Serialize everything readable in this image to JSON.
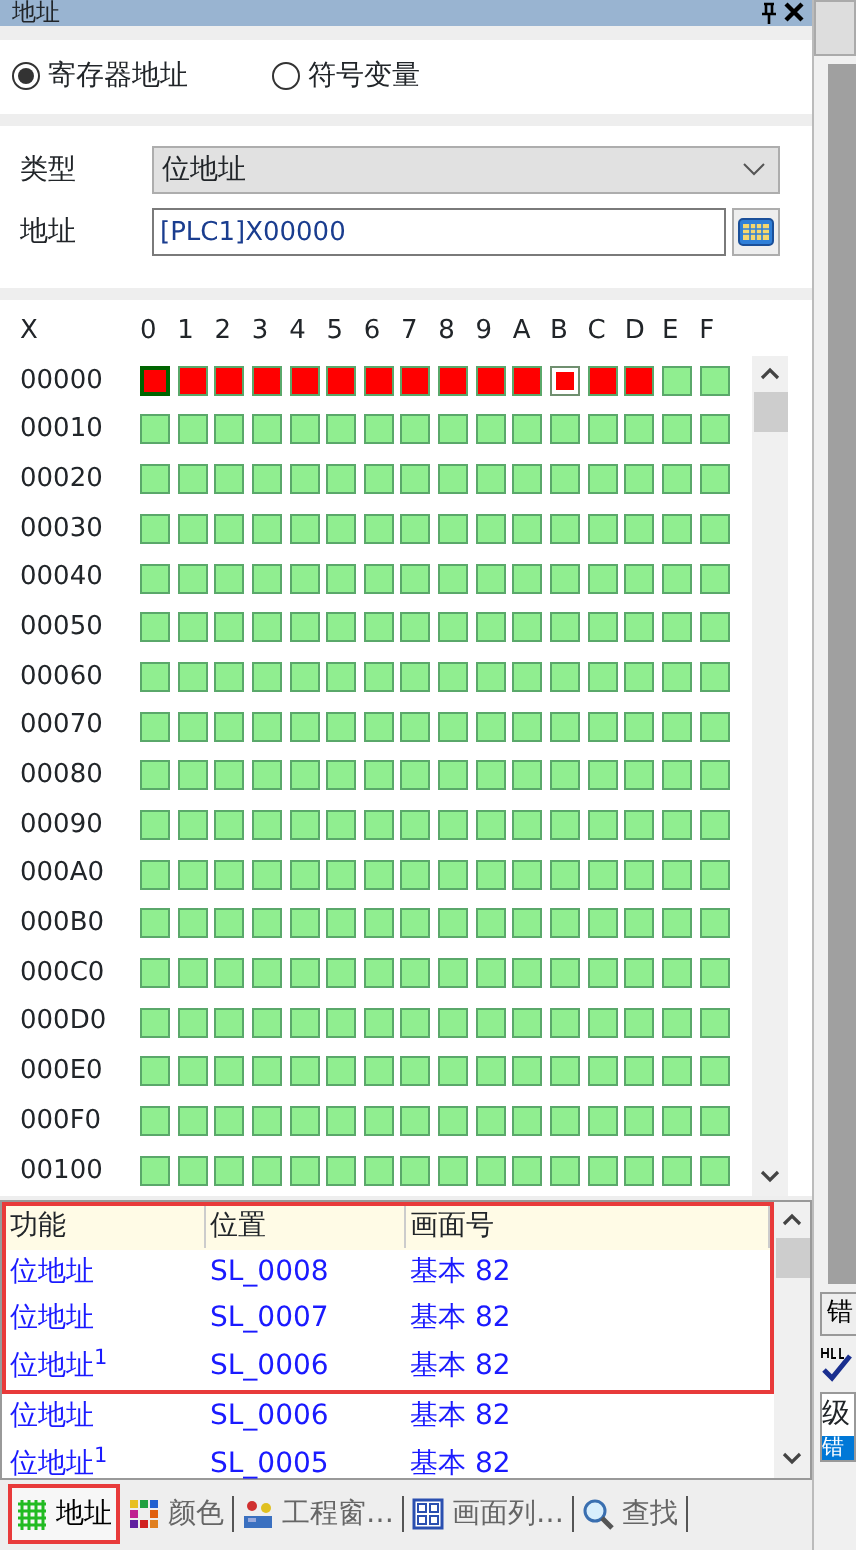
{
  "panel": {
    "title": "地址"
  },
  "mode_options": [
    {
      "label": "寄存器地址",
      "selected": true
    },
    {
      "label": "符号变量",
      "selected": false
    }
  ],
  "form": {
    "type_label": "类型",
    "type_value": "位地址",
    "address_label": "地址",
    "address_value": "[PLC1]X00000"
  },
  "grid": {
    "corner": "X",
    "columns": [
      "0",
      "1",
      "2",
      "3",
      "4",
      "5",
      "6",
      "7",
      "8",
      "9",
      "A",
      "B",
      "C",
      "D",
      "E",
      "F"
    ],
    "rows": [
      {
        "label": "00000",
        "on": [
          true,
          true,
          true,
          true,
          true,
          true,
          true,
          true,
          true,
          true,
          true,
          true,
          true,
          true,
          false,
          false
        ],
        "selected": [
          true,
          false,
          false,
          false,
          false,
          false,
          false,
          false,
          false,
          false,
          false,
          false,
          false,
          false,
          false,
          false
        ],
        "focused": [
          false,
          false,
          false,
          false,
          false,
          false,
          false,
          false,
          false,
          false,
          false,
          true,
          false,
          false,
          false,
          false
        ]
      },
      {
        "label": "00010",
        "on": [
          false,
          false,
          false,
          false,
          false,
          false,
          false,
          false,
          false,
          false,
          false,
          false,
          false,
          false,
          false,
          false
        ],
        "selected": [
          false,
          false,
          false,
          false,
          false,
          false,
          false,
          false,
          false,
          false,
          false,
          false,
          false,
          false,
          false,
          false
        ],
        "focused": [
          false,
          false,
          false,
          false,
          false,
          false,
          false,
          false,
          false,
          false,
          false,
          false,
          false,
          false,
          false,
          false
        ]
      },
      {
        "label": "00020",
        "on": [
          false,
          false,
          false,
          false,
          false,
          false,
          false,
          false,
          false,
          false,
          false,
          false,
          false,
          false,
          false,
          false
        ],
        "selected": [
          false,
          false,
          false,
          false,
          false,
          false,
          false,
          false,
          false,
          false,
          false,
          false,
          false,
          false,
          false,
          false
        ],
        "focused": [
          false,
          false,
          false,
          false,
          false,
          false,
          false,
          false,
          false,
          false,
          false,
          false,
          false,
          false,
          false,
          false
        ]
      },
      {
        "label": "00030",
        "on": [
          false,
          false,
          false,
          false,
          false,
          false,
          false,
          false,
          false,
          false,
          false,
          false,
          false,
          false,
          false,
          false
        ],
        "selected": [
          false,
          false,
          false,
          false,
          false,
          false,
          false,
          false,
          false,
          false,
          false,
          false,
          false,
          false,
          false,
          false
        ],
        "focused": [
          false,
          false,
          false,
          false,
          false,
          false,
          false,
          false,
          false,
          false,
          false,
          false,
          false,
          false,
          false,
          false
        ]
      },
      {
        "label": "00040",
        "on": [
          false,
          false,
          false,
          false,
          false,
          false,
          false,
          false,
          false,
          false,
          false,
          false,
          false,
          false,
          false,
          false
        ],
        "selected": [
          false,
          false,
          false,
          false,
          false,
          false,
          false,
          false,
          false,
          false,
          false,
          false,
          false,
          false,
          false,
          false
        ],
        "focused": [
          false,
          false,
          false,
          false,
          false,
          false,
          false,
          false,
          false,
          false,
          false,
          false,
          false,
          false,
          false,
          false
        ]
      },
      {
        "label": "00050",
        "on": [
          false,
          false,
          false,
          false,
          false,
          false,
          false,
          false,
          false,
          false,
          false,
          false,
          false,
          false,
          false,
          false
        ],
        "selected": [
          false,
          false,
          false,
          false,
          false,
          false,
          false,
          false,
          false,
          false,
          false,
          false,
          false,
          false,
          false,
          false
        ],
        "focused": [
          false,
          false,
          false,
          false,
          false,
          false,
          false,
          false,
          false,
          false,
          false,
          false,
          false,
          false,
          false,
          false
        ]
      },
      {
        "label": "00060",
        "on": [
          false,
          false,
          false,
          false,
          false,
          false,
          false,
          false,
          false,
          false,
          false,
          false,
          false,
          false,
          false,
          false
        ],
        "selected": [
          false,
          false,
          false,
          false,
          false,
          false,
          false,
          false,
          false,
          false,
          false,
          false,
          false,
          false,
          false,
          false
        ],
        "focused": [
          false,
          false,
          false,
          false,
          false,
          false,
          false,
          false,
          false,
          false,
          false,
          false,
          false,
          false,
          false,
          false
        ]
      },
      {
        "label": "00070",
        "on": [
          false,
          false,
          false,
          false,
          false,
          false,
          false,
          false,
          false,
          false,
          false,
          false,
          false,
          false,
          false,
          false
        ],
        "selected": [
          false,
          false,
          false,
          false,
          false,
          false,
          false,
          false,
          false,
          false,
          false,
          false,
          false,
          false,
          false,
          false
        ],
        "focused": [
          false,
          false,
          false,
          false,
          false,
          false,
          false,
          false,
          false,
          false,
          false,
          false,
          false,
          false,
          false,
          false
        ]
      },
      {
        "label": "00080",
        "on": [
          false,
          false,
          false,
          false,
          false,
          false,
          false,
          false,
          false,
          false,
          false,
          false,
          false,
          false,
          false,
          false
        ],
        "selected": [
          false,
          false,
          false,
          false,
          false,
          false,
          false,
          false,
          false,
          false,
          false,
          false,
          false,
          false,
          false,
          false
        ],
        "focused": [
          false,
          false,
          false,
          false,
          false,
          false,
          false,
          false,
          false,
          false,
          false,
          false,
          false,
          false,
          false,
          false
        ]
      },
      {
        "label": "00090",
        "on": [
          false,
          false,
          false,
          false,
          false,
          false,
          false,
          false,
          false,
          false,
          false,
          false,
          false,
          false,
          false,
          false
        ],
        "selected": [
          false,
          false,
          false,
          false,
          false,
          false,
          false,
          false,
          false,
          false,
          false,
          false,
          false,
          false,
          false,
          false
        ],
        "focused": [
          false,
          false,
          false,
          false,
          false,
          false,
          false,
          false,
          false,
          false,
          false,
          false,
          false,
          false,
          false,
          false
        ]
      },
      {
        "label": "000A0",
        "on": [
          false,
          false,
          false,
          false,
          false,
          false,
          false,
          false,
          false,
          false,
          false,
          false,
          false,
          false,
          false,
          false
        ],
        "selected": [
          false,
          false,
          false,
          false,
          false,
          false,
          false,
          false,
          false,
          false,
          false,
          false,
          false,
          false,
          false,
          false
        ],
        "focused": [
          false,
          false,
          false,
          false,
          false,
          false,
          false,
          false,
          false,
          false,
          false,
          false,
          false,
          false,
          false,
          false
        ]
      },
      {
        "label": "000B0",
        "on": [
          false,
          false,
          false,
          false,
          false,
          false,
          false,
          false,
          false,
          false,
          false,
          false,
          false,
          false,
          false,
          false
        ],
        "selected": [
          false,
          false,
          false,
          false,
          false,
          false,
          false,
          false,
          false,
          false,
          false,
          false,
          false,
          false,
          false,
          false
        ],
        "focused": [
          false,
          false,
          false,
          false,
          false,
          false,
          false,
          false,
          false,
          false,
          false,
          false,
          false,
          false,
          false,
          false
        ]
      },
      {
        "label": "000C0",
        "on": [
          false,
          false,
          false,
          false,
          false,
          false,
          false,
          false,
          false,
          false,
          false,
          false,
          false,
          false,
          false,
          false
        ],
        "selected": [
          false,
          false,
          false,
          false,
          false,
          false,
          false,
          false,
          false,
          false,
          false,
          false,
          false,
          false,
          false,
          false
        ],
        "focused": [
          false,
          false,
          false,
          false,
          false,
          false,
          false,
          false,
          false,
          false,
          false,
          false,
          false,
          false,
          false,
          false
        ]
      },
      {
        "label": "000D0",
        "on": [
          false,
          false,
          false,
          false,
          false,
          false,
          false,
          false,
          false,
          false,
          false,
          false,
          false,
          false,
          false,
          false
        ],
        "selected": [
          false,
          false,
          false,
          false,
          false,
          false,
          false,
          false,
          false,
          false,
          false,
          false,
          false,
          false,
          false,
          false
        ],
        "focused": [
          false,
          false,
          false,
          false,
          false,
          false,
          false,
          false,
          false,
          false,
          false,
          false,
          false,
          false,
          false,
          false
        ]
      },
      {
        "label": "000E0",
        "on": [
          false,
          false,
          false,
          false,
          false,
          false,
          false,
          false,
          false,
          false,
          false,
          false,
          false,
          false,
          false,
          false
        ],
        "selected": [
          false,
          false,
          false,
          false,
          false,
          false,
          false,
          false,
          false,
          false,
          false,
          false,
          false,
          false,
          false,
          false
        ],
        "focused": [
          false,
          false,
          false,
          false,
          false,
          false,
          false,
          false,
          false,
          false,
          false,
          false,
          false,
          false,
          false,
          false
        ]
      },
      {
        "label": "000F0",
        "on": [
          false,
          false,
          false,
          false,
          false,
          false,
          false,
          false,
          false,
          false,
          false,
          false,
          false,
          false,
          false,
          false
        ],
        "selected": [
          false,
          false,
          false,
          false,
          false,
          false,
          false,
          false,
          false,
          false,
          false,
          false,
          false,
          false,
          false,
          false
        ],
        "focused": [
          false,
          false,
          false,
          false,
          false,
          false,
          false,
          false,
          false,
          false,
          false,
          false,
          false,
          false,
          false,
          false
        ]
      },
      {
        "label": "00100",
        "on": [
          false,
          false,
          false,
          false,
          false,
          false,
          false,
          false,
          false,
          false,
          false,
          false,
          false,
          false,
          false,
          false
        ],
        "selected": [
          false,
          false,
          false,
          false,
          false,
          false,
          false,
          false,
          false,
          false,
          false,
          false,
          false,
          false,
          false,
          false
        ],
        "focused": [
          false,
          false,
          false,
          false,
          false,
          false,
          false,
          false,
          false,
          false,
          false,
          false,
          false,
          false,
          false,
          false
        ]
      }
    ]
  },
  "usage_table": {
    "columns": [
      "功能",
      "位置",
      "画面号"
    ],
    "framed": true,
    "rows": [
      {
        "function": "位地址",
        "position": "SL_0008",
        "screen": "基本 82",
        "framed": true
      },
      {
        "function": "位地址",
        "position": "SL_0007",
        "screen": "基本 82",
        "framed": true
      },
      {
        "function": "位地址$^{1}$",
        "position": "SL_0006",
        "screen": "基本 82",
        "framed": true
      },
      {
        "function": "位地址",
        "position": "SL_0006",
        "screen": "基本 82",
        "framed": false
      },
      {
        "function": "位地址$^{1}$",
        "position": "SL_0005",
        "screen": "基本 82",
        "framed": false
      }
    ]
  },
  "bottom_tabs": [
    {
      "label": "地址",
      "kind": "grid",
      "selected": true,
      "framed": true
    },
    {
      "label": "颜色",
      "kind": "palette",
      "selected": false,
      "framed": false
    },
    {
      "label": "工程窗…",
      "kind": "project",
      "selected": false,
      "framed": false
    },
    {
      "label": "画面列…",
      "kind": "screens",
      "selected": false,
      "framed": false
    },
    {
      "label": "查找",
      "kind": "search",
      "selected": false,
      "framed": false
    }
  ],
  "side_strip": {
    "button_label": "错",
    "level_label": "级",
    "level_tab": "错"
  }
}
